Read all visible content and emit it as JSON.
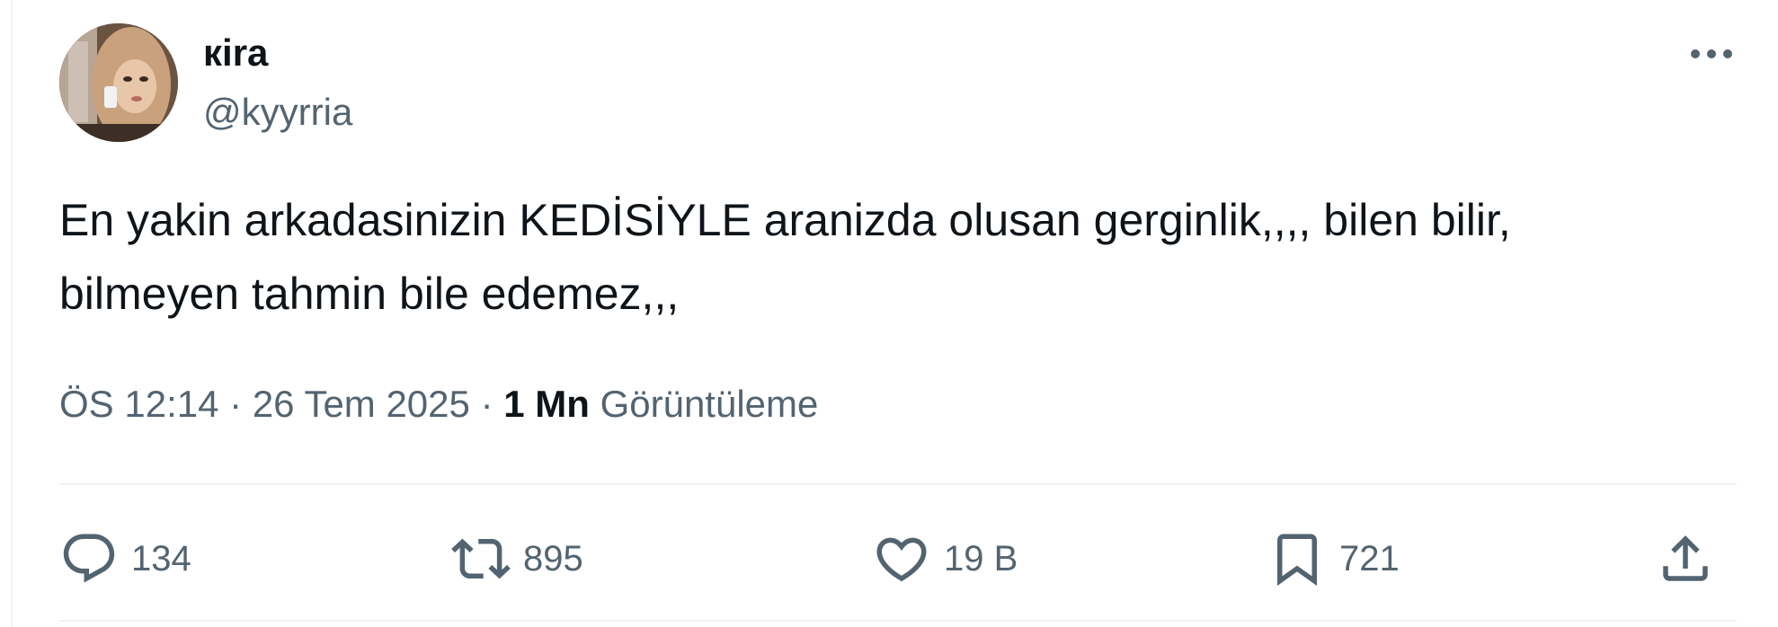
{
  "author": {
    "name": "кira",
    "handle": "@kyyrria"
  },
  "tweet": {
    "text": "En yakin arkadasinizin KEDİSİYLE aranizda olusan gerginlik,,,, bilen bilir,\nbilmeyen tahmin bile edemez,,,"
  },
  "meta": {
    "time": "ÖS 12:14",
    "separator": "·",
    "date": "26 Tem 2025",
    "views_count": "1 Mn",
    "views_label": "Görüntüleme"
  },
  "actions": {
    "reply_count": "134",
    "retweet_count": "895",
    "like_count": "19 B",
    "bookmark_count": "721"
  },
  "icons": {
    "more": "more-horizontal-icon",
    "reply": "reply-icon",
    "retweet": "retweet-icon",
    "like": "heart-icon",
    "bookmark": "bookmark-icon",
    "share": "share-icon"
  },
  "colors": {
    "text_primary": "#0f1419",
    "text_secondary": "#536471",
    "divider": "#eff3f4"
  }
}
